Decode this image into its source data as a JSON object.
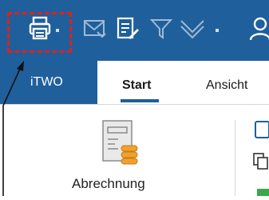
{
  "title_bar": {
    "quick_access": {
      "items": [
        {
          "name": "print-icon"
        },
        {
          "name": "dropdown-arrow-icon"
        },
        {
          "name": "mail-icon"
        },
        {
          "name": "document-edit-icon"
        },
        {
          "name": "filter-icon"
        },
        {
          "name": "chevron-double-down-icon"
        },
        {
          "name": "dropdown-arrow-icon"
        },
        {
          "name": "user-icon"
        }
      ]
    }
  },
  "ribbon": {
    "tabs": [
      {
        "label": "iTWO",
        "selected": false
      },
      {
        "label": "Start",
        "selected": true
      },
      {
        "label": "Ansicht",
        "selected": false
      }
    ],
    "groups": {
      "abrechnung": {
        "label": "Abrechnung",
        "icon": "billing-icon"
      }
    }
  },
  "colors": {
    "title_bar_bg": "#1f5f9c",
    "accent": "#1f5f9c",
    "selection_outline": "#e0201b",
    "icon_orange": "#f0a030"
  }
}
